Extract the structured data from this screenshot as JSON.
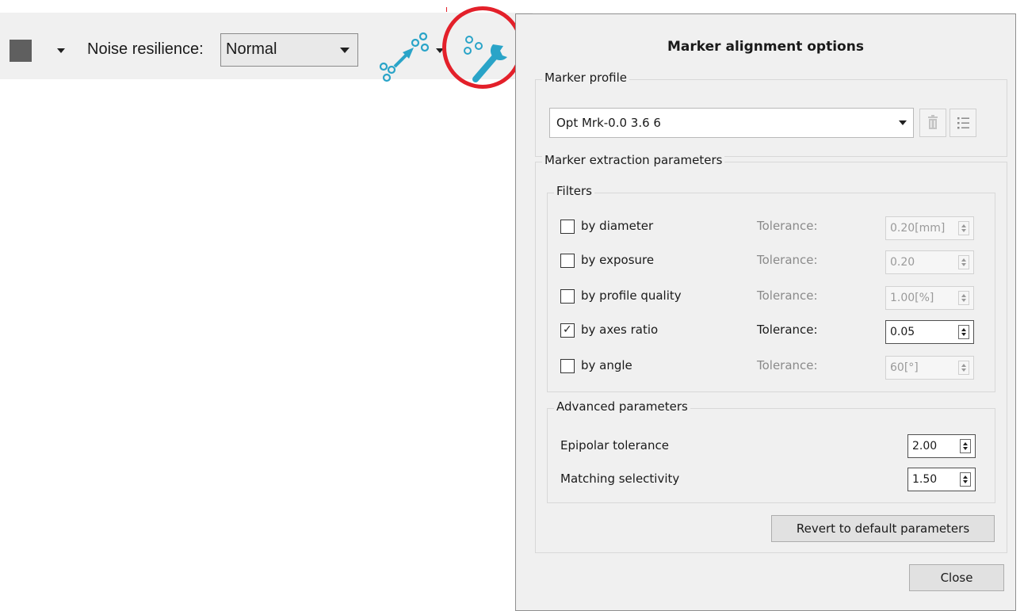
{
  "toolbar": {
    "noise_label": "Noise resilience:",
    "noise_value": "Normal",
    "marker_tool_icon": "marker-alignment-icon",
    "marker_options_icon": "marker-options-wrench-icon",
    "swatch_color": "#5f5f5f"
  },
  "annotation": {
    "highlight_color": "#e3202a",
    "arrow_color": "#e3202a"
  },
  "dialog": {
    "title": "Marker alignment options",
    "marker_profile": {
      "group_label": "Marker profile",
      "selected": "Opt Mrk-0.0 3.6 6",
      "delete_icon": "trash-icon",
      "manage_icon": "list-icon"
    },
    "extraction": {
      "group_label": "Marker extraction parameters",
      "filters": {
        "group_label": "Filters",
        "items": [
          {
            "label": "by diameter",
            "checked": false,
            "tolerance_label": "Tolerance:",
            "value": "0.20[mm]",
            "enabled": false
          },
          {
            "label": "by exposure",
            "checked": false,
            "tolerance_label": "Tolerance:",
            "value": "0.20",
            "enabled": false
          },
          {
            "label": "by profile quality",
            "checked": false,
            "tolerance_label": "Tolerance:",
            "value": "1.00[%]",
            "enabled": false
          },
          {
            "label": "by axes ratio",
            "checked": true,
            "tolerance_label": "Tolerance:",
            "value": "0.05",
            "enabled": true
          },
          {
            "label": "by angle",
            "checked": false,
            "tolerance_label": "Tolerance:",
            "value": "60[°]",
            "enabled": false
          }
        ]
      },
      "advanced": {
        "group_label": "Advanced parameters",
        "items": [
          {
            "label": "Epipolar tolerance",
            "value": "2.00"
          },
          {
            "label": "Matching selectivity",
            "value": "1.50"
          }
        ]
      },
      "revert_label": "Revert to default parameters"
    },
    "close_label": "Close"
  }
}
